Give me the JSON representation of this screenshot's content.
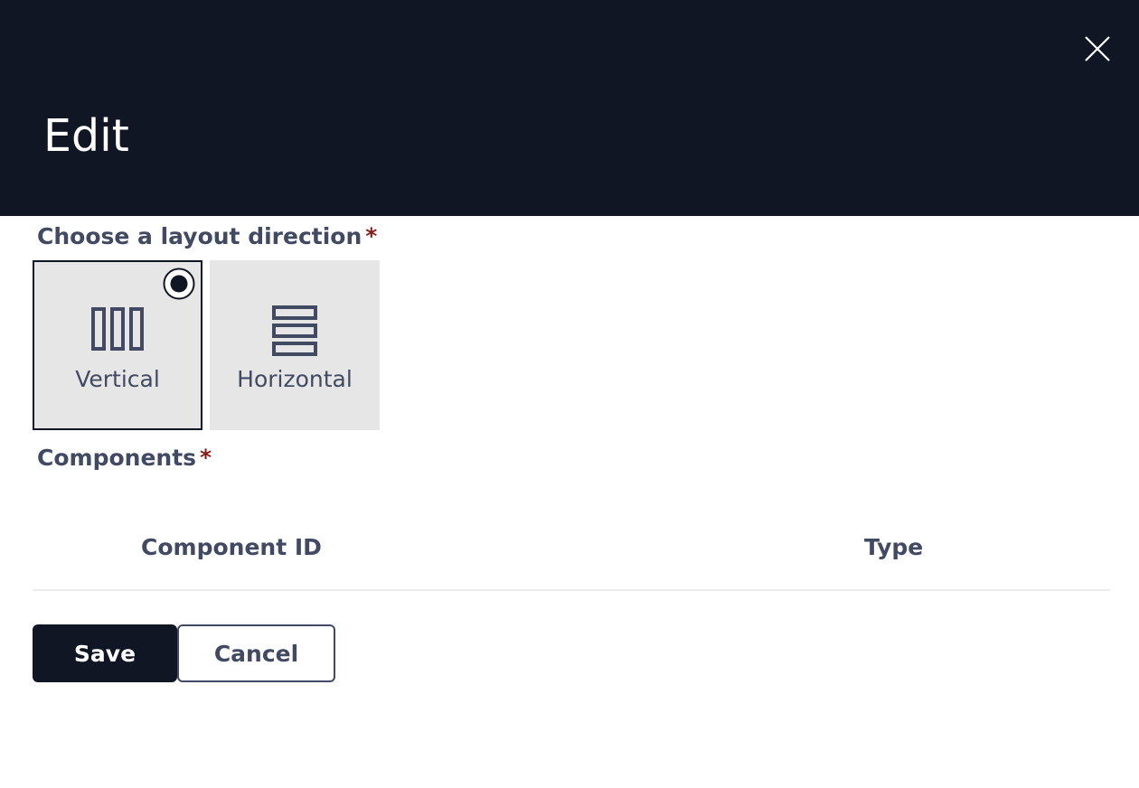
{
  "dialog": {
    "title": "Edit",
    "close_icon": "close-icon"
  },
  "layout_direction": {
    "label": "Choose a layout direction",
    "required_marker": "*",
    "selected": "Vertical",
    "options": [
      {
        "label": "Vertical",
        "icon": "columns-icon",
        "selected": true
      },
      {
        "label": "Horizontal",
        "icon": "rows-icon",
        "selected": false
      }
    ]
  },
  "components": {
    "label": "Components",
    "required_marker": "*",
    "columns": [
      "Component ID",
      "Type"
    ],
    "rows": []
  },
  "actions": {
    "save_label": "Save",
    "cancel_label": "Cancel"
  },
  "colors": {
    "header_bg": "#111625",
    "text": "#414a62",
    "required": "#8a1c1c",
    "option_bg": "#e6e6e6"
  }
}
